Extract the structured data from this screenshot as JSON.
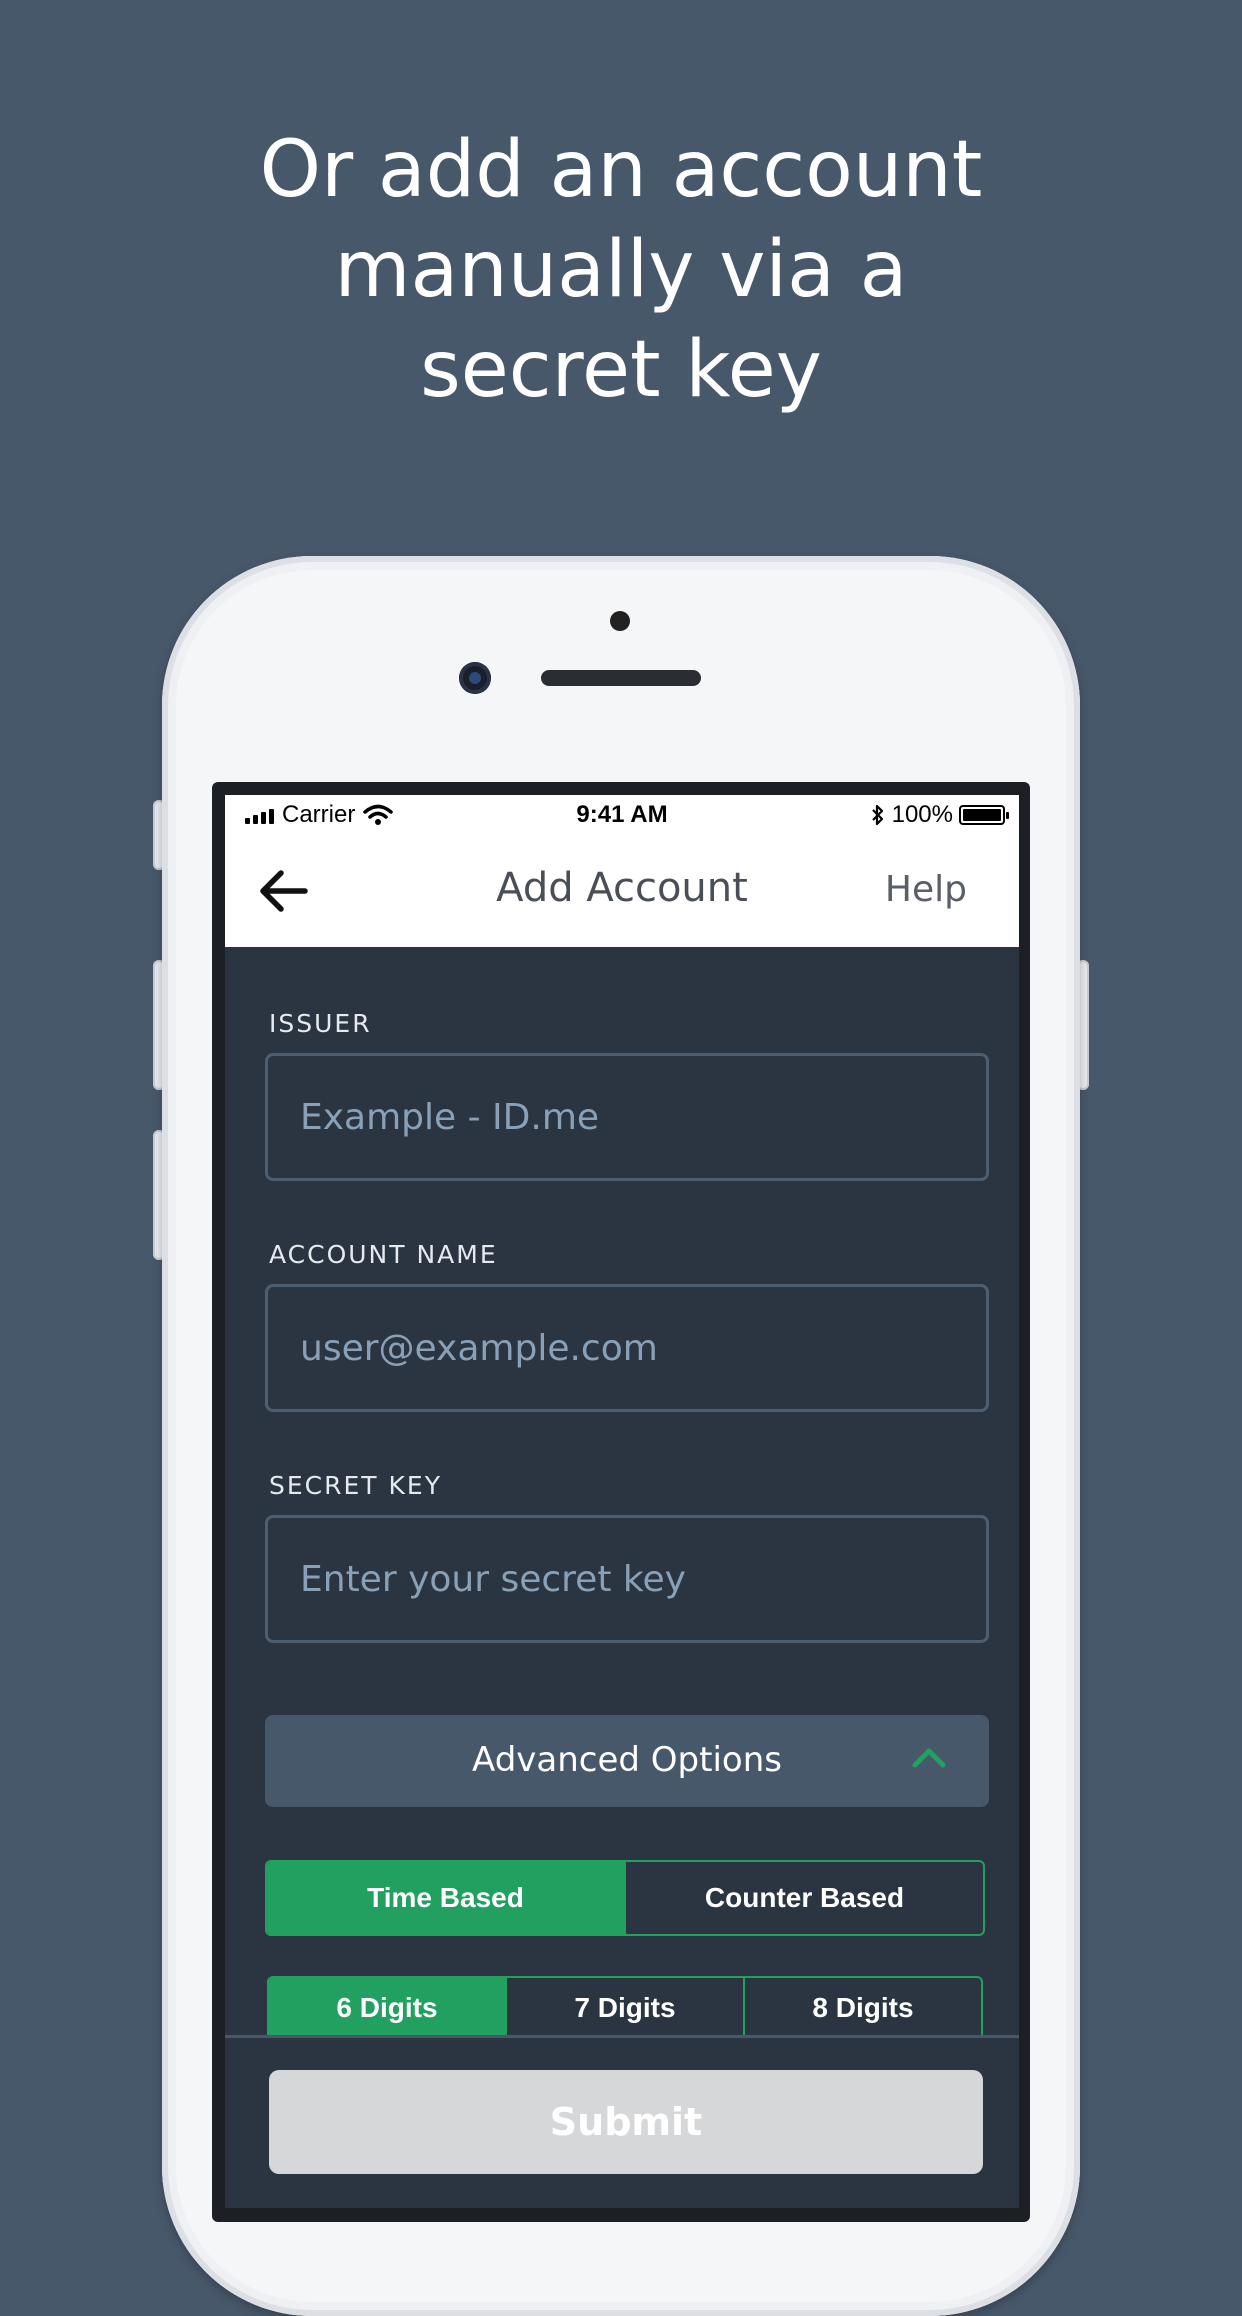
{
  "headline": {
    "line1": "Or add an account",
    "line2": "manually via a",
    "line3": "secret key"
  },
  "statusbar": {
    "carrier": "Carrier",
    "time": "9:41 AM",
    "battery": "100%"
  },
  "navbar": {
    "title": "Add Account",
    "help": "Help"
  },
  "form": {
    "issuer": {
      "label": "ISSUER",
      "placeholder": "Example - ID.me",
      "value": ""
    },
    "account_name": {
      "label": "ACCOUNT NAME",
      "placeholder": "user@example.com",
      "value": ""
    },
    "secret_key": {
      "label": "SECRET KEY",
      "placeholder": "Enter your secret key",
      "value": ""
    }
  },
  "advanced": {
    "label": "Advanced Options",
    "expanded": true,
    "type_options": [
      "Time Based",
      "Counter Based"
    ],
    "type_selected": "Time Based",
    "digit_options": [
      "6 Digits",
      "7 Digits",
      "8 Digits"
    ],
    "digit_selected": "6 Digits"
  },
  "submit_label": "Submit",
  "colors": {
    "background": "#48586b",
    "screen_bg": "#2a3541",
    "accent_green": "#21a060",
    "submit_disabled": "#d6d7d9"
  }
}
